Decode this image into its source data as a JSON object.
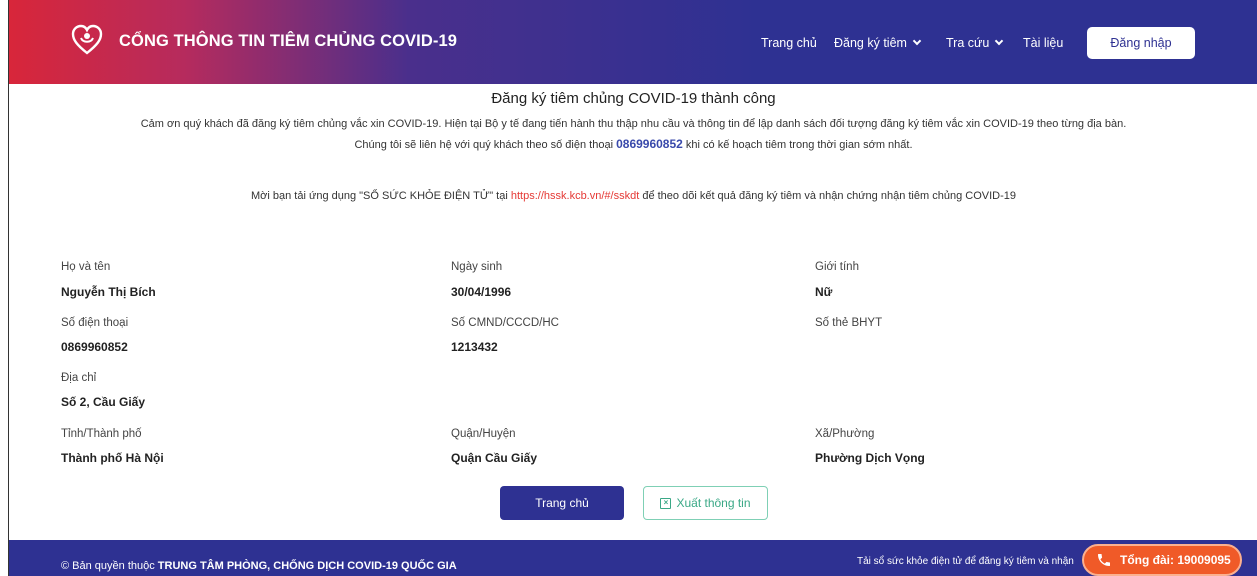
{
  "header": {
    "brand": "CỔNG THÔNG TIN TIÊM CHỦNG COVID-19",
    "nav": {
      "home": "Trang chủ",
      "register": "Đăng ký tiêm",
      "lookup": "Tra cứu",
      "docs": "Tài liệu",
      "login": "Đăng nhập"
    }
  },
  "main": {
    "title": "Đăng ký tiêm chủng COVID-19 thành công",
    "thanks_line1": "Cảm ơn quý khách đã đăng ký tiêm chủng vắc xin COVID-19. Hiện tại Bộ y tế đang tiến hành thu thập nhu cầu và thông tin để lập danh sách đối tượng đăng ký tiêm vắc xin COVID-19 theo từng địa bàn.",
    "contact_prefix": "Chúng tôi sẽ liên hệ với quý khách theo số điện thoại",
    "contact_phone": "0869960852",
    "contact_suffix": "khi có kế hoạch tiêm trong thời gian sớm nhất.",
    "app_prefix": "Mời bạn tải ứng dụng \"SỔ SỨC KHỎE ĐIỆN TỬ\" tại",
    "app_link": "https://hssk.kcb.vn/#/sskdt",
    "app_suffix": "để theo dõi kết quả đăng ký tiêm và nhận chứng nhận tiêm chủng COVID-19"
  },
  "fields": {
    "name_label": "Họ và tên",
    "name_value": "Nguyễn Thị Bích",
    "dob_label": "Ngày sinh",
    "dob_value": "30/04/1996",
    "gender_label": "Giới tính",
    "gender_value": "Nữ",
    "phone_label": "Số điện thoại",
    "phone_value": "0869960852",
    "id_label": "Số CMND/CCCD/HC",
    "id_value": "1213432",
    "insurance_label": "Số thẻ BHYT",
    "address_label": "Địa chỉ",
    "address_value": "Số 2, Cầu Giấy",
    "province_label": "Tỉnh/Thành phố",
    "province_value": "Thành phố Hà Nội",
    "district_label": "Quận/Huyện",
    "district_value": "Quận Cầu Giấy",
    "ward_label": "Xã/Phường",
    "ward_value": "Phường Dịch Vọng"
  },
  "actions": {
    "home": "Trang chủ",
    "export": "Xuất thông tin"
  },
  "footer": {
    "copyright_prefix": "© Bản quyền thuộc",
    "copyright_org": "TRUNG TÂM PHÒNG, CHỐNG DỊCH COVID-19 QUỐC GIA",
    "note": "Tải sổ sức khỏe điện tử để đăng ký tiêm và nhận",
    "hotline": "Tổng đài: 19009095"
  },
  "icons": {
    "logo": "heart-logo-icon",
    "chevron": "chevron-down-icon",
    "excel": "excel-icon",
    "phone": "phone-icon"
  },
  "colors": {
    "brand_blue": "#2e3192",
    "brand_red": "#d8263a",
    "hotline_orange": "#f05a28",
    "export_green": "#3aa886"
  }
}
